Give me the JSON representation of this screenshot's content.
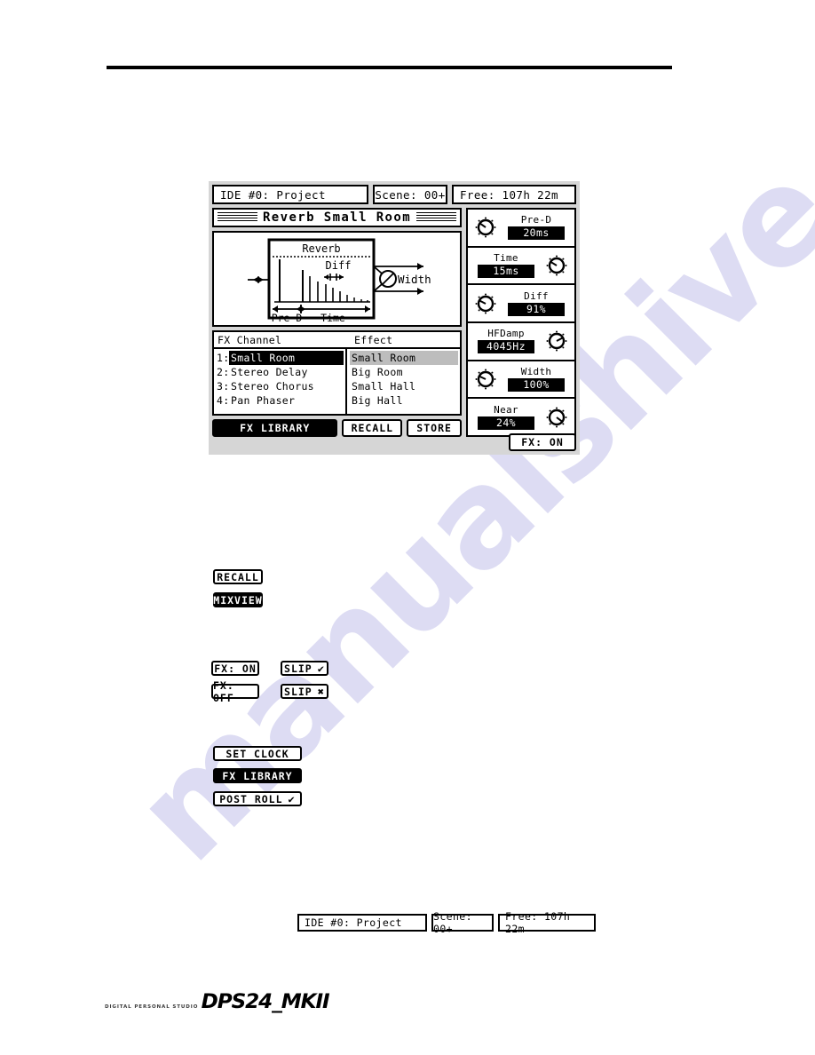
{
  "lcd": {
    "status": {
      "project": "IDE #0: Project",
      "scene": "Scene: 00+",
      "free": "Free: 107h 22m"
    },
    "title": "Reverb Small Room",
    "diagram": {
      "block_label": "Reverb",
      "diff_label": "Diff",
      "pre_d_label": "Pre-D",
      "time_label": "Time",
      "width_label": "Width"
    },
    "lists": {
      "header_channel": "FX Channel",
      "header_effect": "Effect",
      "channels": [
        {
          "num": "1:",
          "name": "Small Room",
          "selected": true
        },
        {
          "num": "2:",
          "name": "Stereo Delay",
          "selected": false
        },
        {
          "num": "3:",
          "name": "Stereo Chorus",
          "selected": false
        },
        {
          "num": "4:",
          "name": "Pan Phaser",
          "selected": false
        }
      ],
      "effects": [
        {
          "name": "Small Room",
          "selected": true
        },
        {
          "name": "Big Room",
          "selected": false
        },
        {
          "name": "Small Hall",
          "selected": false
        },
        {
          "name": "Big Hall",
          "selected": false
        }
      ]
    },
    "knobs": [
      {
        "label": "Pre-D",
        "value": "20ms",
        "knob_side": "left",
        "angle": -35
      },
      {
        "label": "Time",
        "value": "15ms",
        "knob_side": "right",
        "angle": -30
      },
      {
        "label": "Diff",
        "value": "91%",
        "knob_side": "left",
        "angle": -40
      },
      {
        "label": "HFDamp",
        "value": "4045Hz",
        "knob_side": "right",
        "angle": 20
      },
      {
        "label": "Width",
        "value": "100%",
        "knob_side": "left",
        "angle": -25
      },
      {
        "label": "Near",
        "value": "24%",
        "knob_side": "right",
        "angle": 35
      }
    ],
    "buttons": {
      "fx_library": "FX LIBRARY",
      "recall": "RECALL",
      "store": "STORE",
      "fx_on": "FX: ON"
    }
  },
  "examples": {
    "recall": "RECALL",
    "mixview": "MIXVIEW",
    "fx_on": "FX: ON",
    "fx_off": "FX: OFF",
    "slip_check": "SLIP",
    "slip_x": "SLIP",
    "check_mark": "✔",
    "x_mark": "✖",
    "set_clock": "SET CLOCK",
    "fx_library": "FX LIBRARY",
    "post_roll": "POST ROLL"
  },
  "statusbar": {
    "project": "IDE #0: Project",
    "scene": "Scene: 00+",
    "free": "Free: 107h 22m"
  },
  "footer": {
    "subtitle": "DIGITAL PERSONAL STUDIO",
    "logo": "DPS24_MKII"
  },
  "watermark": {
    "text": "manualshive.com"
  },
  "colors": {
    "lcd_bg": "#d6d6d6",
    "ink": "#000000",
    "highlight": "#bdbdbd",
    "watermark": "#c9c8ec"
  }
}
